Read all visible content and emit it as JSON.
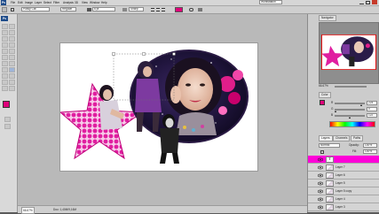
{
  "menubar": {
    "logo": "Ps",
    "items": [
      "File",
      "Edit",
      "Image",
      "Layer",
      "Select",
      "Filter",
      "Analysis",
      "3D",
      "View",
      "Window",
      "Help"
    ],
    "workspace_label": "Workstation"
  },
  "optionbar": {
    "font_family": "Pussy Cat",
    "font_style": "Regular",
    "font_size": "6 pt",
    "antialias": "Sharp",
    "text_color": "#e0007a"
  },
  "document": {
    "zoom": "66.67%",
    "doc_size": "Doc: 1,40M/9,16M"
  },
  "navigator": {
    "tab_label": "Navigator",
    "zoom_value": "66.67%"
  },
  "color_panel": {
    "tab_label": "Color",
    "foreground": "#e0007a",
    "channels": [
      {
        "label": "R",
        "value": "224",
        "fill": 0.88
      },
      {
        "label": "G",
        "value": "0",
        "fill": 0.0
      },
      {
        "label": "B",
        "value": "122",
        "fill": 0.48
      }
    ]
  },
  "layers_panel": {
    "tabs": [
      "Layers",
      "Channels",
      "Paths"
    ],
    "blend_mode": "Normal",
    "opacity_label": "Opacity:",
    "opacity": "100%",
    "fill_label": "Fill:",
    "fill": "100%",
    "layers": [
      {
        "name": "T",
        "type": "text",
        "selected": true
      },
      {
        "name": "Layer 7",
        "type": "image",
        "selected": false
      },
      {
        "name": "Layer 6",
        "type": "image",
        "selected": false
      },
      {
        "name": "Layer 5",
        "type": "image",
        "selected": false
      },
      {
        "name": "Layer 5 copy",
        "type": "image",
        "selected": false
      },
      {
        "name": "Layer 4",
        "type": "image",
        "selected": false
      },
      {
        "name": "Layer 3",
        "type": "image",
        "selected": false
      }
    ]
  },
  "colors": {
    "accent_pink": "#e0007a",
    "layer_highlight": "#ff00d8",
    "selection_blue": "#2a64c8"
  }
}
